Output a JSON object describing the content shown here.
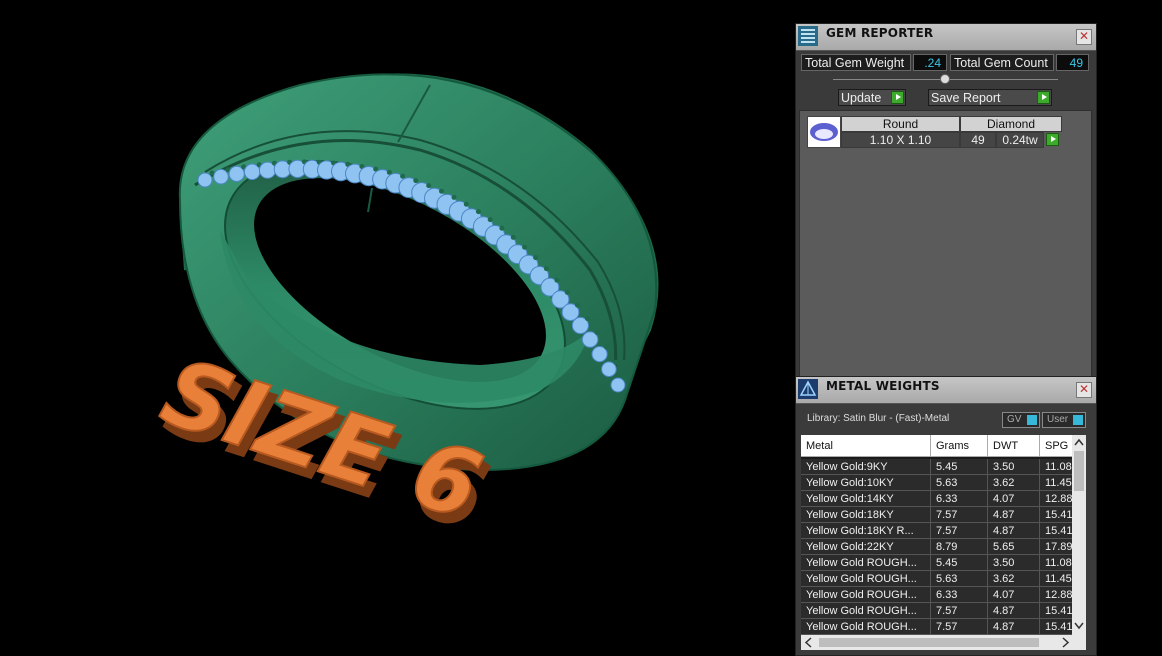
{
  "viewport": {
    "text": "SIZE 6"
  },
  "gem_reporter": {
    "title": "GEM REPORTER",
    "total_weight_label": "Total Gem Weight",
    "total_weight_value": ".24",
    "total_count_label": "Total Gem Count",
    "total_count_value": "49",
    "update_label": "Update",
    "save_label": "Save Report",
    "table": {
      "shape_header": "Round",
      "type_header": "Diamond",
      "size": "1.10 X 1.10",
      "count": "49",
      "weight": "0.24tw"
    },
    "close": "✕"
  },
  "metal_weights": {
    "title": "METAL WEIGHTS",
    "library": "Library: Satin Blur - (Fast)-Metal",
    "gv_label": "GV",
    "user_label": "User",
    "close": "✕",
    "columns": [
      "Metal",
      "Grams",
      "DWT",
      "SPG"
    ],
    "rows": [
      [
        "Yellow Gold:9KY",
        "5.45",
        "3.50",
        "11.08"
      ],
      [
        "Yellow Gold:10KY",
        "5.63",
        "3.62",
        "11.45"
      ],
      [
        "Yellow Gold:14KY",
        "6.33",
        "4.07",
        "12.88"
      ],
      [
        "Yellow Gold:18KY",
        "7.57",
        "4.87",
        "15.41"
      ],
      [
        "Yellow Gold:18KY R...",
        "7.57",
        "4.87",
        "15.41"
      ],
      [
        "Yellow Gold:22KY",
        "8.79",
        "5.65",
        "17.89"
      ],
      [
        "Yellow Gold ROUGH...",
        "5.45",
        "3.50",
        "11.08"
      ],
      [
        "Yellow Gold ROUGH...",
        "5.63",
        "3.62",
        "11.45"
      ],
      [
        "Yellow Gold ROUGH...",
        "6.33",
        "4.07",
        "12.88"
      ],
      [
        "Yellow Gold ROUGH...",
        "7.57",
        "4.87",
        "15.41"
      ],
      [
        "Yellow Gold ROUGH...",
        "7.57",
        "4.87",
        "15.41"
      ]
    ]
  },
  "colors": {
    "ring": "#2f8c68",
    "gems": "#8fc3f2",
    "text3d": "#e8803a",
    "accent": "#38c8e8",
    "play": "#3caa2a"
  }
}
